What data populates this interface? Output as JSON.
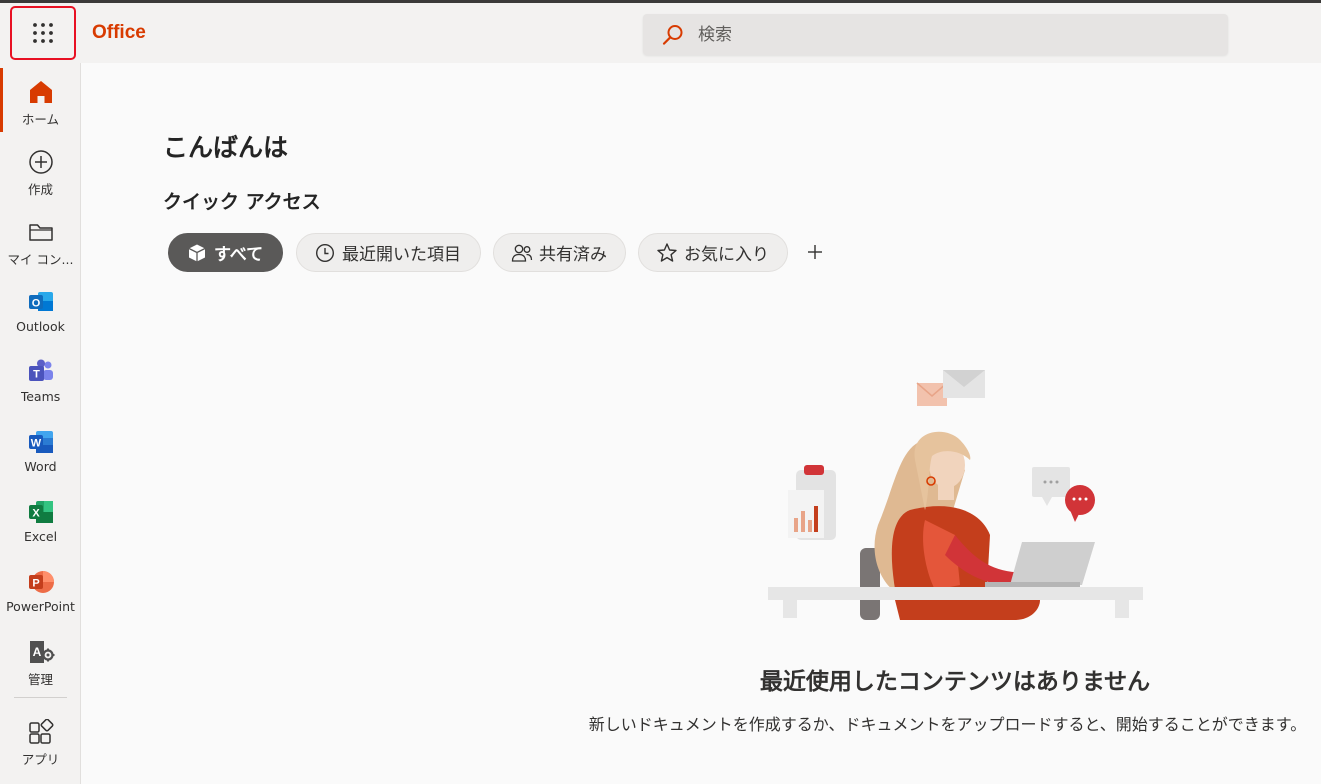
{
  "header": {
    "brand": "Office",
    "search_placeholder": "検索"
  },
  "rail": {
    "items": [
      {
        "label": "ホーム",
        "icon": "home-icon"
      },
      {
        "label": "作成",
        "icon": "create-icon"
      },
      {
        "label": "マイ コン...",
        "icon": "folder-icon"
      },
      {
        "label": "Outlook",
        "icon": "outlook-icon"
      },
      {
        "label": "Teams",
        "icon": "teams-icon"
      },
      {
        "label": "Word",
        "icon": "word-icon"
      },
      {
        "label": "Excel",
        "icon": "excel-icon"
      },
      {
        "label": "PowerPoint",
        "icon": "powerpoint-icon"
      },
      {
        "label": "管理",
        "icon": "admin-icon"
      },
      {
        "label": "アプリ",
        "icon": "apps-icon"
      }
    ]
  },
  "main": {
    "greeting": "こんばんは",
    "quick_access": "クイック アクセス",
    "filters": [
      {
        "label": "すべて",
        "icon": "cube-icon",
        "selected": true
      },
      {
        "label": "最近開いた項目",
        "icon": "clock-icon",
        "selected": false
      },
      {
        "label": "共有済み",
        "icon": "people-icon",
        "selected": false
      },
      {
        "label": "お気に入り",
        "icon": "star-icon",
        "selected": false
      }
    ],
    "empty_title": "最近使用したコンテンツはありません",
    "empty_desc": "新しいドキュメントを作成するか、ドキュメントをアップロードすると、開始することができます。"
  },
  "colors": {
    "accent": "#d83b01",
    "selected_pill": "#5a5958",
    "outlook": "#0f6cbd",
    "teams": "#5b5fc7",
    "word": "#185abd",
    "excel": "#107c41",
    "powerpoint": "#c43e1c"
  }
}
